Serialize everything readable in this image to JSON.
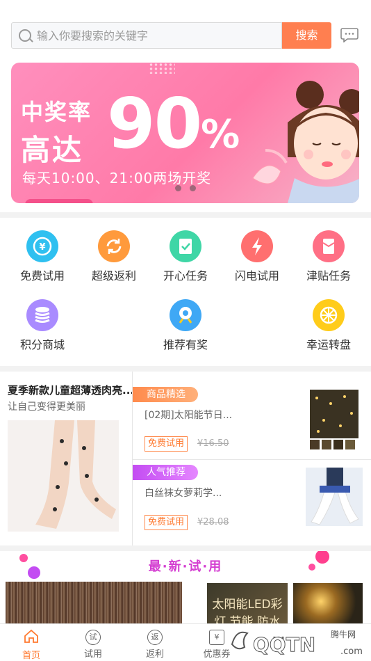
{
  "search": {
    "placeholder": "输入你要搜索的关键字",
    "button": "搜索"
  },
  "banner": {
    "line1": "中奖率",
    "line2": "高达",
    "big": "90",
    "percent": "%",
    "sub": "每天10:00、21:00两场开奖"
  },
  "shortcuts": [
    {
      "label": "免费试用",
      "icon": "yen-refresh-icon",
      "color": "#2fc0f0"
    },
    {
      "label": "超级返利",
      "icon": "refresh-icon",
      "color": "#ff9a3c"
    },
    {
      "label": "开心任务",
      "icon": "clipboard-check-icon",
      "color": "#3fd6a6"
    },
    {
      "label": "闪电试用",
      "icon": "lightning-icon",
      "color": "#ff6f6f"
    },
    {
      "label": "津贴任务",
      "icon": "envelope-icon",
      "color": "#ff6f85"
    },
    {
      "label": "积分商城",
      "icon": "coins-stack-icon",
      "color": "#a98bff"
    },
    {
      "label": "推荐有奖",
      "icon": "target-icon",
      "color": "#3fa8f5"
    },
    {
      "label": "幸运转盘",
      "icon": "wheel-icon",
      "color": "#ffcc1a"
    }
  ],
  "featured": {
    "title": "夏季新款儿童超薄透肉亮...",
    "subtitle": "让自己变得更美丽"
  },
  "items": [
    {
      "tag": "商品精选",
      "name": "[02期]太阳能节日...",
      "free": "免费试用",
      "price": "¥16.50"
    },
    {
      "tag": "人气推荐",
      "name": "白丝袜女萝莉学...",
      "free": "免费试用",
      "price": "¥28.08"
    }
  ],
  "latest": {
    "title": "最·新·试·用",
    "card_text": "太阳能LED彩灯 节能 防水"
  },
  "tabs": [
    {
      "label": "首页",
      "icon": "home-icon"
    },
    {
      "label": "试用",
      "icon": "trial-icon",
      "glyph": "试"
    },
    {
      "label": "返利",
      "icon": "rebate-icon",
      "glyph": "返"
    },
    {
      "label": "优惠券",
      "icon": "coupon-icon",
      "glyph": "¥"
    },
    {
      "label": "...",
      "icon": "more-icon"
    }
  ],
  "watermark": {
    "brand": "QQTN",
    "site": "腾牛网",
    "domain": ".com"
  },
  "colors": {
    "accent": "#ff7f50",
    "latest": "#d43dd1"
  }
}
